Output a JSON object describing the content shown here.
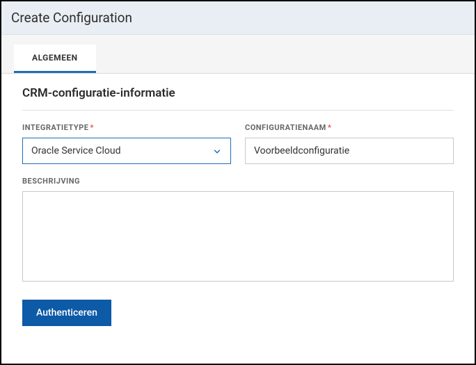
{
  "header": {
    "title": "Create Configuration"
  },
  "tabs": {
    "active": "ALGEMEEN"
  },
  "section": {
    "title": "CRM-configuratie-informatie"
  },
  "form": {
    "integration_type": {
      "label": "INTEGRATIETYPE",
      "value": "Oracle Service Cloud"
    },
    "config_name": {
      "label": "CONFIGURATIENAAM",
      "value": "Voorbeeldconfiguratie"
    },
    "description": {
      "label": "BESCHRIJVING",
      "value": ""
    }
  },
  "actions": {
    "authenticate": "Authenticeren"
  },
  "required_marker": "*"
}
